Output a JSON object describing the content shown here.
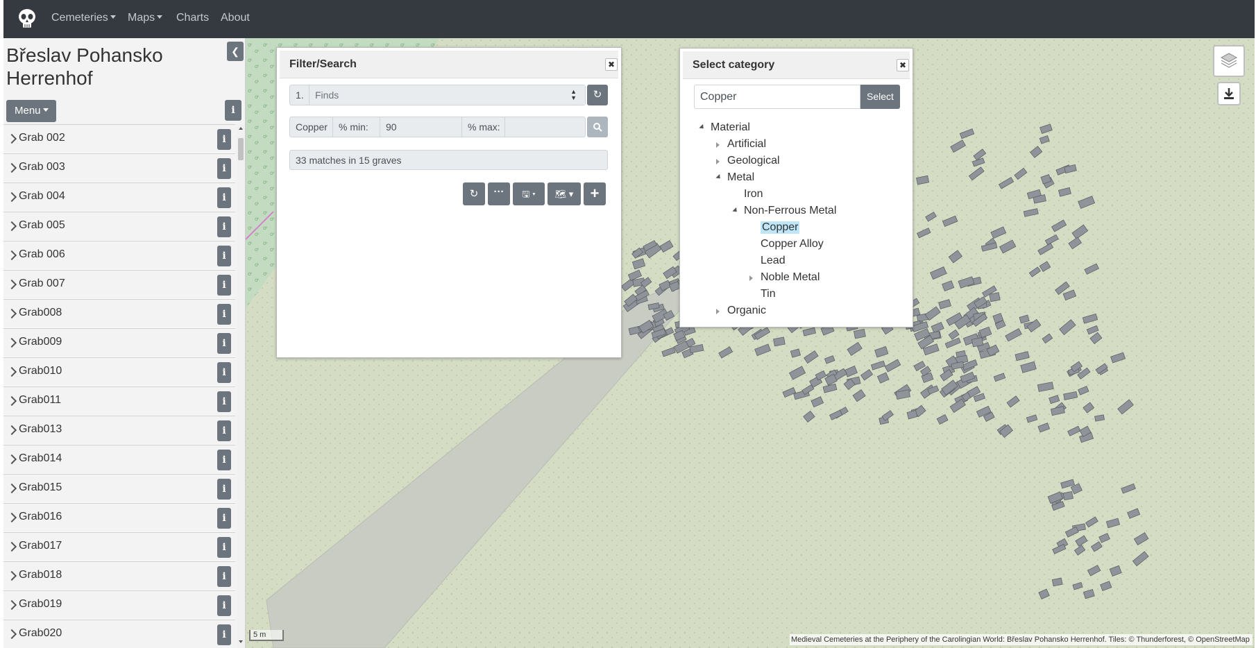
{
  "navbar": {
    "logo_icon": "skull-icon",
    "items": [
      {
        "label": "Cemeteries",
        "dropdown": true
      },
      {
        "label": "Maps",
        "dropdown": true
      },
      {
        "label": "Charts",
        "dropdown": false
      },
      {
        "label": "About",
        "dropdown": false
      }
    ]
  },
  "sidebar": {
    "title": "Břeslav Pohansko Herrenhof",
    "menu_label": "Menu",
    "graves": [
      "Grab 002",
      "Grab 003",
      "Grab 004",
      "Grab 005",
      "Grab 006",
      "Grab 007",
      "Grab008",
      "Grab009",
      "Grab010",
      "Grab011",
      "Grab013",
      "Grab014",
      "Grab015",
      "Grab016",
      "Grab017",
      "Grab018",
      "Grab019",
      "Grab020"
    ]
  },
  "filter_panel": {
    "title": "Filter/Search",
    "row_number": "1.",
    "select_value": "Finds",
    "material": "Copper",
    "min_label": "% min:",
    "min_value": "90",
    "max_label": "% max:",
    "max_value": "",
    "result": "33 matches in 15 graves"
  },
  "category_panel": {
    "title": "Select category",
    "search_value": "Copper",
    "select_label": "Select",
    "tree": {
      "root": "Material",
      "artificial": "Artificial",
      "geological": "Geological",
      "metal": "Metal",
      "iron": "Iron",
      "non_ferrous": "Non-Ferrous Metal",
      "copper": "Copper",
      "copper_alloy": "Copper Alloy",
      "lead": "Lead",
      "noble_metal": "Noble Metal",
      "tin": "Tin",
      "organic": "Organic"
    }
  },
  "map": {
    "scale": "5 m",
    "attribution": "Medieval Cemeteries at the Periphery of the Carolingian World: Břeslav Pohansko Herrenhof. Tiles: © Thunderforest, © OpenStreetMap",
    "colors": {
      "background": "#d5dcc4",
      "grave_fill": "#8f949a",
      "road": "#c8ccc3",
      "forest": "#c3dcc1"
    }
  }
}
